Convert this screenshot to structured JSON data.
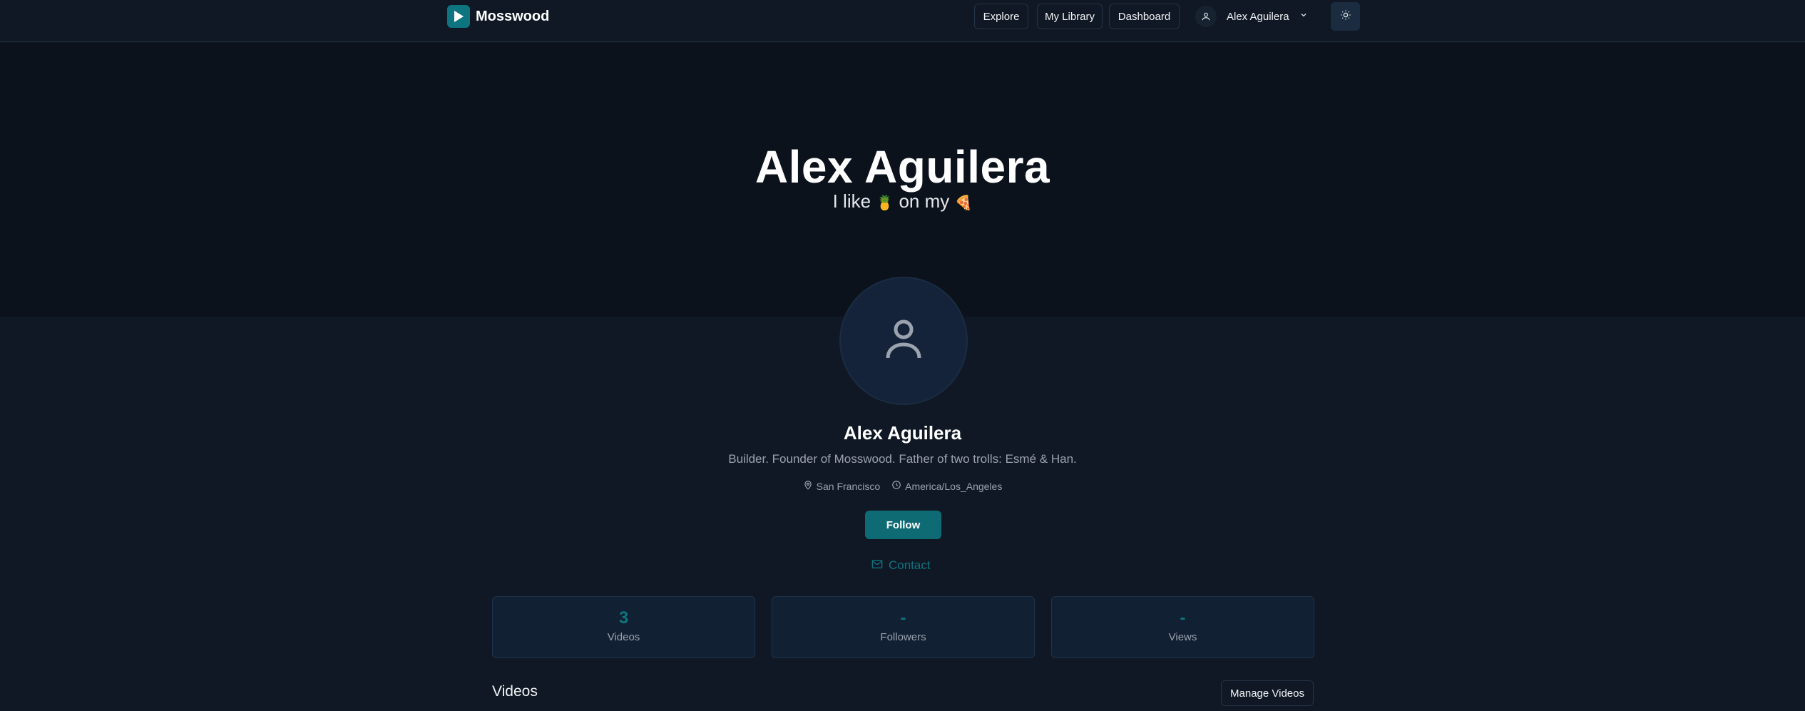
{
  "header": {
    "brand": "Mosswood",
    "nav": [
      "Explore",
      "My Library",
      "Dashboard"
    ],
    "user_name": "Alex Aguilera",
    "icons": {
      "logo": "play-icon",
      "user": "user-icon",
      "chevron": "chevron-down-icon",
      "theme": "sun-icon"
    }
  },
  "hero": {
    "title": "Alex Aguilera",
    "subtitle_prefix": "I like",
    "subtitle_mid": "on my",
    "emoji1": "🍍",
    "emoji2": "🍕"
  },
  "profile": {
    "name": "Alex Aguilera",
    "bio": "Builder. Founder of Mosswood. Father of two trolls: Esmé & Han.",
    "location": "San Francisco",
    "timezone": "America/Los_Angeles",
    "follow_label": "Follow",
    "contact_label": "Contact"
  },
  "stats": [
    {
      "value": "3",
      "label": "Videos"
    },
    {
      "value": "-",
      "label": "Followers"
    },
    {
      "value": "-",
      "label": "Views"
    }
  ],
  "videos_section": {
    "title": "Videos",
    "manage_label": "Manage Videos"
  },
  "colors": {
    "accent": "#0e7480",
    "background": "#0f1824",
    "hero_background": "#0b121b",
    "card_background": "#112033"
  }
}
